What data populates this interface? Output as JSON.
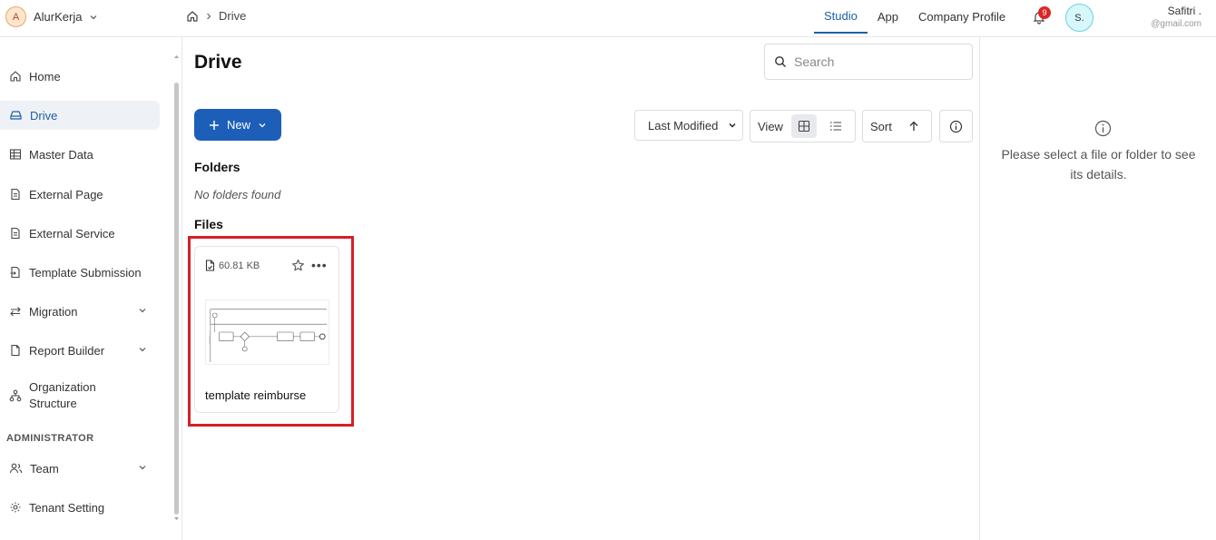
{
  "org": {
    "avatar_letter": "A",
    "name": "AlurKerja"
  },
  "breadcrumb": {
    "current": "Drive"
  },
  "top_tabs": [
    {
      "label": "Studio",
      "active": true
    },
    {
      "label": "App",
      "active": false
    },
    {
      "label": "Company Profile",
      "active": false
    }
  ],
  "notifications": {
    "count": "9"
  },
  "user": {
    "initials": "S.",
    "name": "Safitri .",
    "email": "@gmail.com"
  },
  "sidebar": {
    "items": [
      {
        "label": "Home",
        "icon": "home-icon"
      },
      {
        "label": "Drive",
        "icon": "drive-icon",
        "active": true
      },
      {
        "label": "Master Data",
        "icon": "table-icon"
      },
      {
        "label": "External Page",
        "icon": "document-icon"
      },
      {
        "label": "External Service",
        "icon": "document-icon"
      },
      {
        "label": "Template Submission",
        "icon": "file-import-icon"
      },
      {
        "label": "Migration",
        "icon": "arrows-icon",
        "expandable": true
      },
      {
        "label": "Report Builder",
        "icon": "report-icon",
        "expandable": true
      },
      {
        "label": "Organization Structure",
        "icon": "org-chart-icon"
      }
    ],
    "admin_section_label": "ADMINISTRATOR",
    "admin_items": [
      {
        "label": "Team",
        "icon": "team-icon",
        "expandable": true
      },
      {
        "label": "Tenant Setting",
        "icon": "gear-icon"
      }
    ]
  },
  "main": {
    "title": "Drive",
    "search_placeholder": "Search",
    "new_label": "New",
    "sort_by": "Last Modified",
    "view_label": "View",
    "sort_label": "Sort",
    "folders_title": "Folders",
    "folders_empty": "No folders found",
    "files_title": "Files",
    "files": [
      {
        "name": "template reimburse",
        "size": "60.81 KB"
      }
    ]
  },
  "details": {
    "placeholder": "Please select a file or folder to see its details."
  },
  "colors": {
    "accent": "#1d5fa8",
    "primary_button": "#1d5fb8",
    "highlight": "#d81f26"
  }
}
